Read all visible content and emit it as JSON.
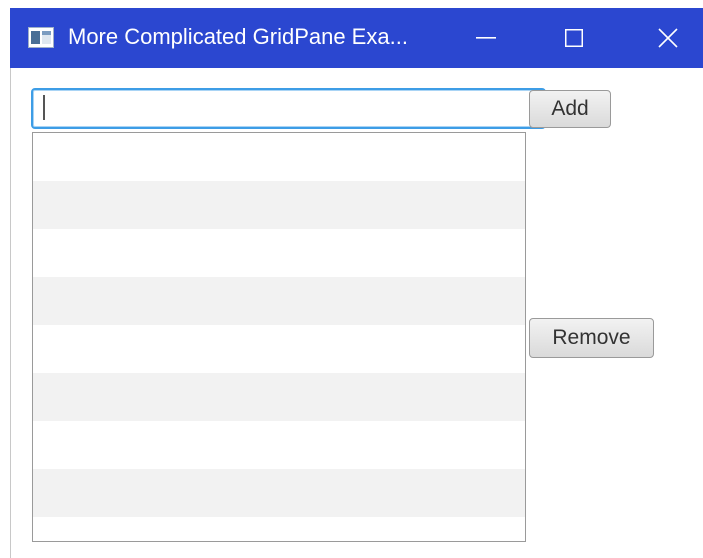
{
  "window": {
    "title": "More Complicated GridPane Exa...",
    "icons": {
      "app": "java-app-icon",
      "minimize": "minimize-icon",
      "maximize": "maximize-icon",
      "close": "close-icon"
    },
    "titlebar_color": "#2b47d0"
  },
  "form": {
    "input": {
      "value": "",
      "placeholder": ""
    },
    "add_label": "Add",
    "remove_label": "Remove"
  },
  "list": {
    "items": [
      "",
      "",
      "",
      "",
      "",
      "",
      "",
      "",
      ""
    ]
  },
  "colors": {
    "focus_border": "#3d9de6",
    "row_alt": "#f2f2f2"
  }
}
